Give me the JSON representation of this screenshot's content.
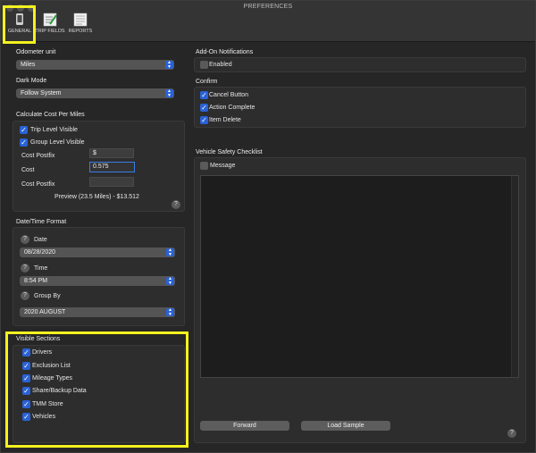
{
  "window": {
    "title": "PREFERENCES"
  },
  "toolbar": [
    {
      "label": "GENERAL",
      "icon": "phone-icon"
    },
    {
      "label": "TRIP FIELDS",
      "icon": "edit-form-icon"
    },
    {
      "label": "REPORTS",
      "icon": "report-icon"
    }
  ],
  "odometer": {
    "title": "Odometer unit",
    "value": "Miles"
  },
  "dark_mode": {
    "title": "Dark Mode",
    "value": "Follow System"
  },
  "cost": {
    "title": "Calculate Cost Per Miles",
    "trip_level": "Trip Level Visible",
    "group_level": "Group Level Visible",
    "postfix_label": "Cost Postfix",
    "postfix_value": "$",
    "cost_label": "Cost",
    "cost_value": "0.575",
    "postfix2_label": "Cost Postfix",
    "postfix2_value": "",
    "preview": "Preview (23.5 Miles) - $13.512"
  },
  "datetime": {
    "title": "Date/Time Format",
    "date_label": "Date",
    "date_value": "08/28/2020",
    "time_label": "Time",
    "time_value": "8:54 PM",
    "group_label": "Group By",
    "group_value": "2020 AUGUST"
  },
  "visible_sections": {
    "title": "Visible Sections",
    "items": [
      "Drivers",
      "Exclusion List",
      "Mileage Types",
      "Share/Backup Data",
      "TMM Store",
      "Vehicles"
    ]
  },
  "addon": {
    "title": "Add-On Notifications",
    "enabled": "Enabled"
  },
  "confirm": {
    "title": "Confirm",
    "items": [
      "Cancel Button",
      "Action Complete",
      "Item Delete"
    ]
  },
  "checklist": {
    "title": "Vehicle Safety Checklist",
    "message": "Message",
    "forward": "Forward",
    "load_sample": "Load Sample"
  },
  "help_glyph": "?",
  "check_glyph": "✓",
  "colors": {
    "accent": "#2a62d6",
    "highlight": "#f4f21e",
    "background": "#262626"
  }
}
